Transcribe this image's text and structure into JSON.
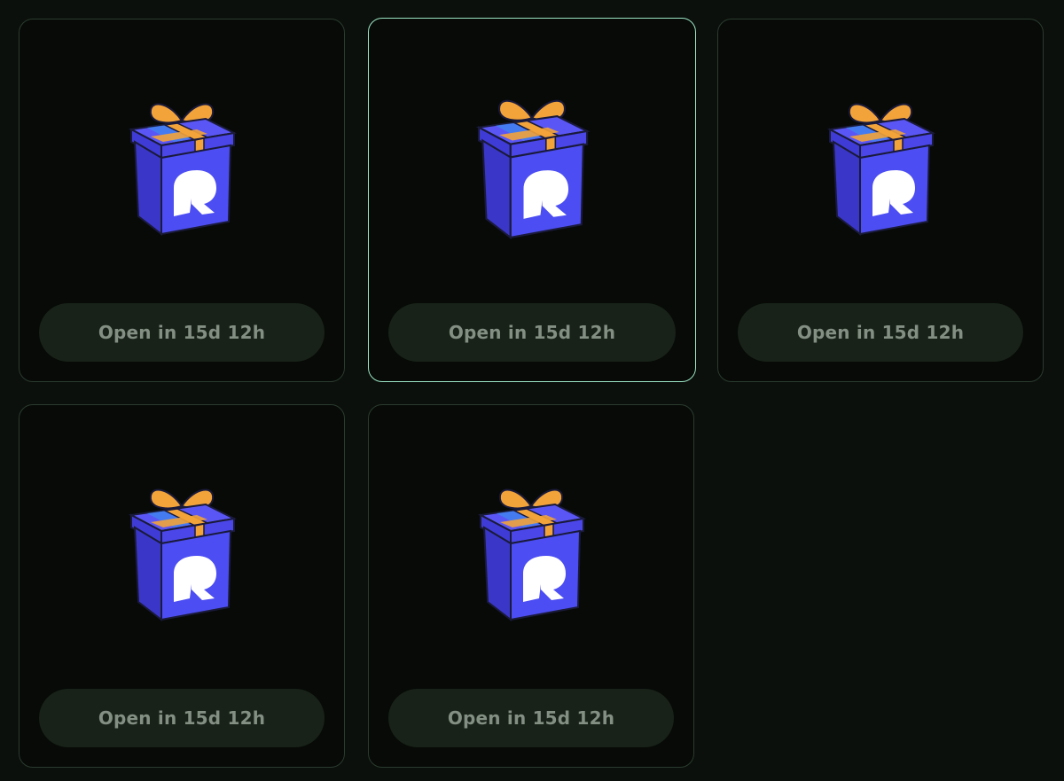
{
  "rewards": {
    "cards": [
      {
        "button_label": "Open in 15d 12h",
        "selected": false
      },
      {
        "button_label": "Open in 15d 12h",
        "selected": true
      },
      {
        "button_label": "Open in 15d 12h",
        "selected": false
      },
      {
        "button_label": "Open in 15d 12h",
        "selected": false
      },
      {
        "button_label": "Open in 15d 12h",
        "selected": false
      }
    ]
  },
  "gift_icon": {
    "name": "gift-box-icon",
    "box_color": "#4c4df2",
    "ribbon_color": "#f2a33a",
    "logo_glyph": "R",
    "logo_color": "#ffffff"
  },
  "colors": {
    "background": "#0c100c",
    "card_background": "#070a07",
    "card_border": "#2a3b2f",
    "card_border_selected": "#9be4c4",
    "button_background": "#182218",
    "button_text": "#848f84"
  }
}
